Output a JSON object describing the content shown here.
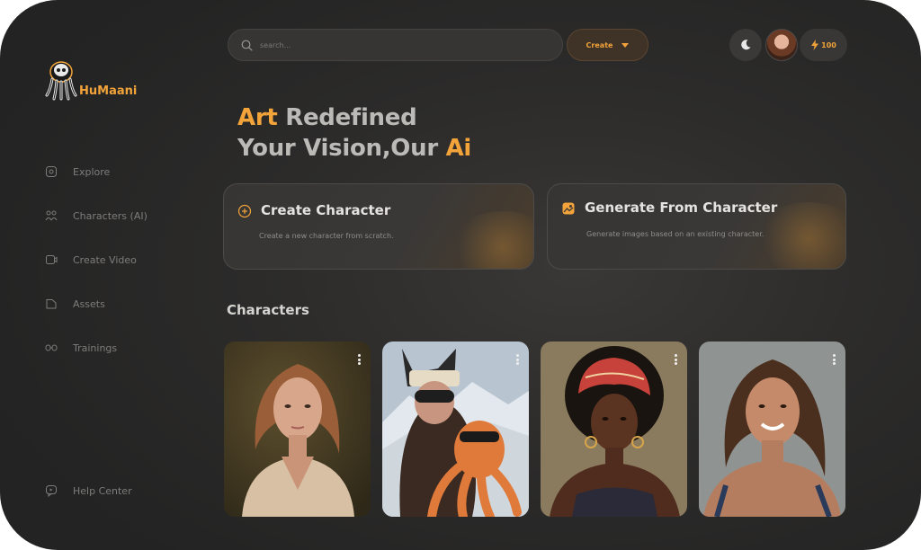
{
  "brand": {
    "name": "HuMaani"
  },
  "sidebar": {
    "items": [
      {
        "label": "Explore",
        "icon": "compass-icon"
      },
      {
        "label": "Characters (AI)",
        "icon": "people-icon"
      },
      {
        "label": "Create Video",
        "icon": "video-icon"
      },
      {
        "label": "Assets",
        "icon": "folder-icon"
      },
      {
        "label": "Trainings",
        "icon": "glasses-icon"
      }
    ],
    "help": {
      "label": "Help Center",
      "icon": "help-chat-icon"
    }
  },
  "topbar": {
    "search_placeholder": "search...",
    "create_label": "Create",
    "credits": "100"
  },
  "hero": {
    "line1_accent": "Art",
    "line1_rest": " Redefined",
    "line2_rest": "Your Vision,Our ",
    "line2_accent": "Ai"
  },
  "cards": [
    {
      "title": "Create Character",
      "desc": "Create a new character from scratch.",
      "icon": "plus-circle-icon"
    },
    {
      "title": "Generate From Character",
      "desc": "Generate images based on an existing character.",
      "icon": "image-gallery-icon"
    }
  ],
  "characters": {
    "title": "Characters"
  },
  "colors": {
    "accent": "#f2a33a",
    "background": "#2b2a29",
    "muted": "#7e7d7b"
  }
}
